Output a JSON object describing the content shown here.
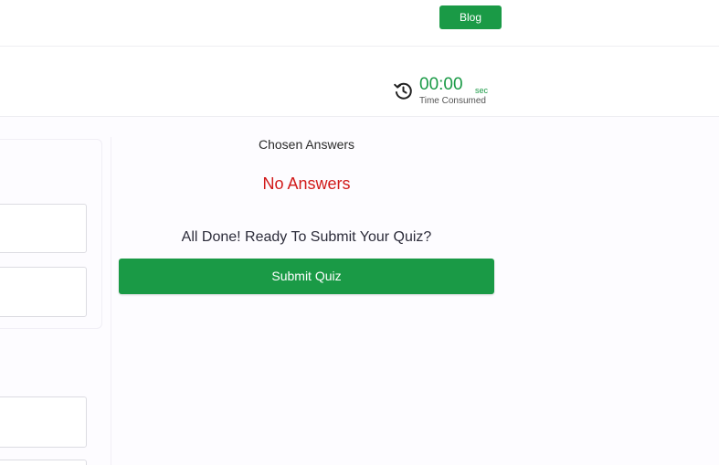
{
  "topbar": {
    "blog_label": "Blog"
  },
  "timer": {
    "value": "00:00",
    "unit": "sec",
    "label": "Time Consumed",
    "icon": "history-icon"
  },
  "summary": {
    "chosen_label": "Chosen Answers",
    "no_answers": "No Answers",
    "ready_text": "All Done! Ready To Submit Your Quiz?",
    "submit_label": "Submit Quiz"
  },
  "colors": {
    "accent": "#1a9a46",
    "error": "#d11a1a",
    "background": "#fdfcff"
  }
}
